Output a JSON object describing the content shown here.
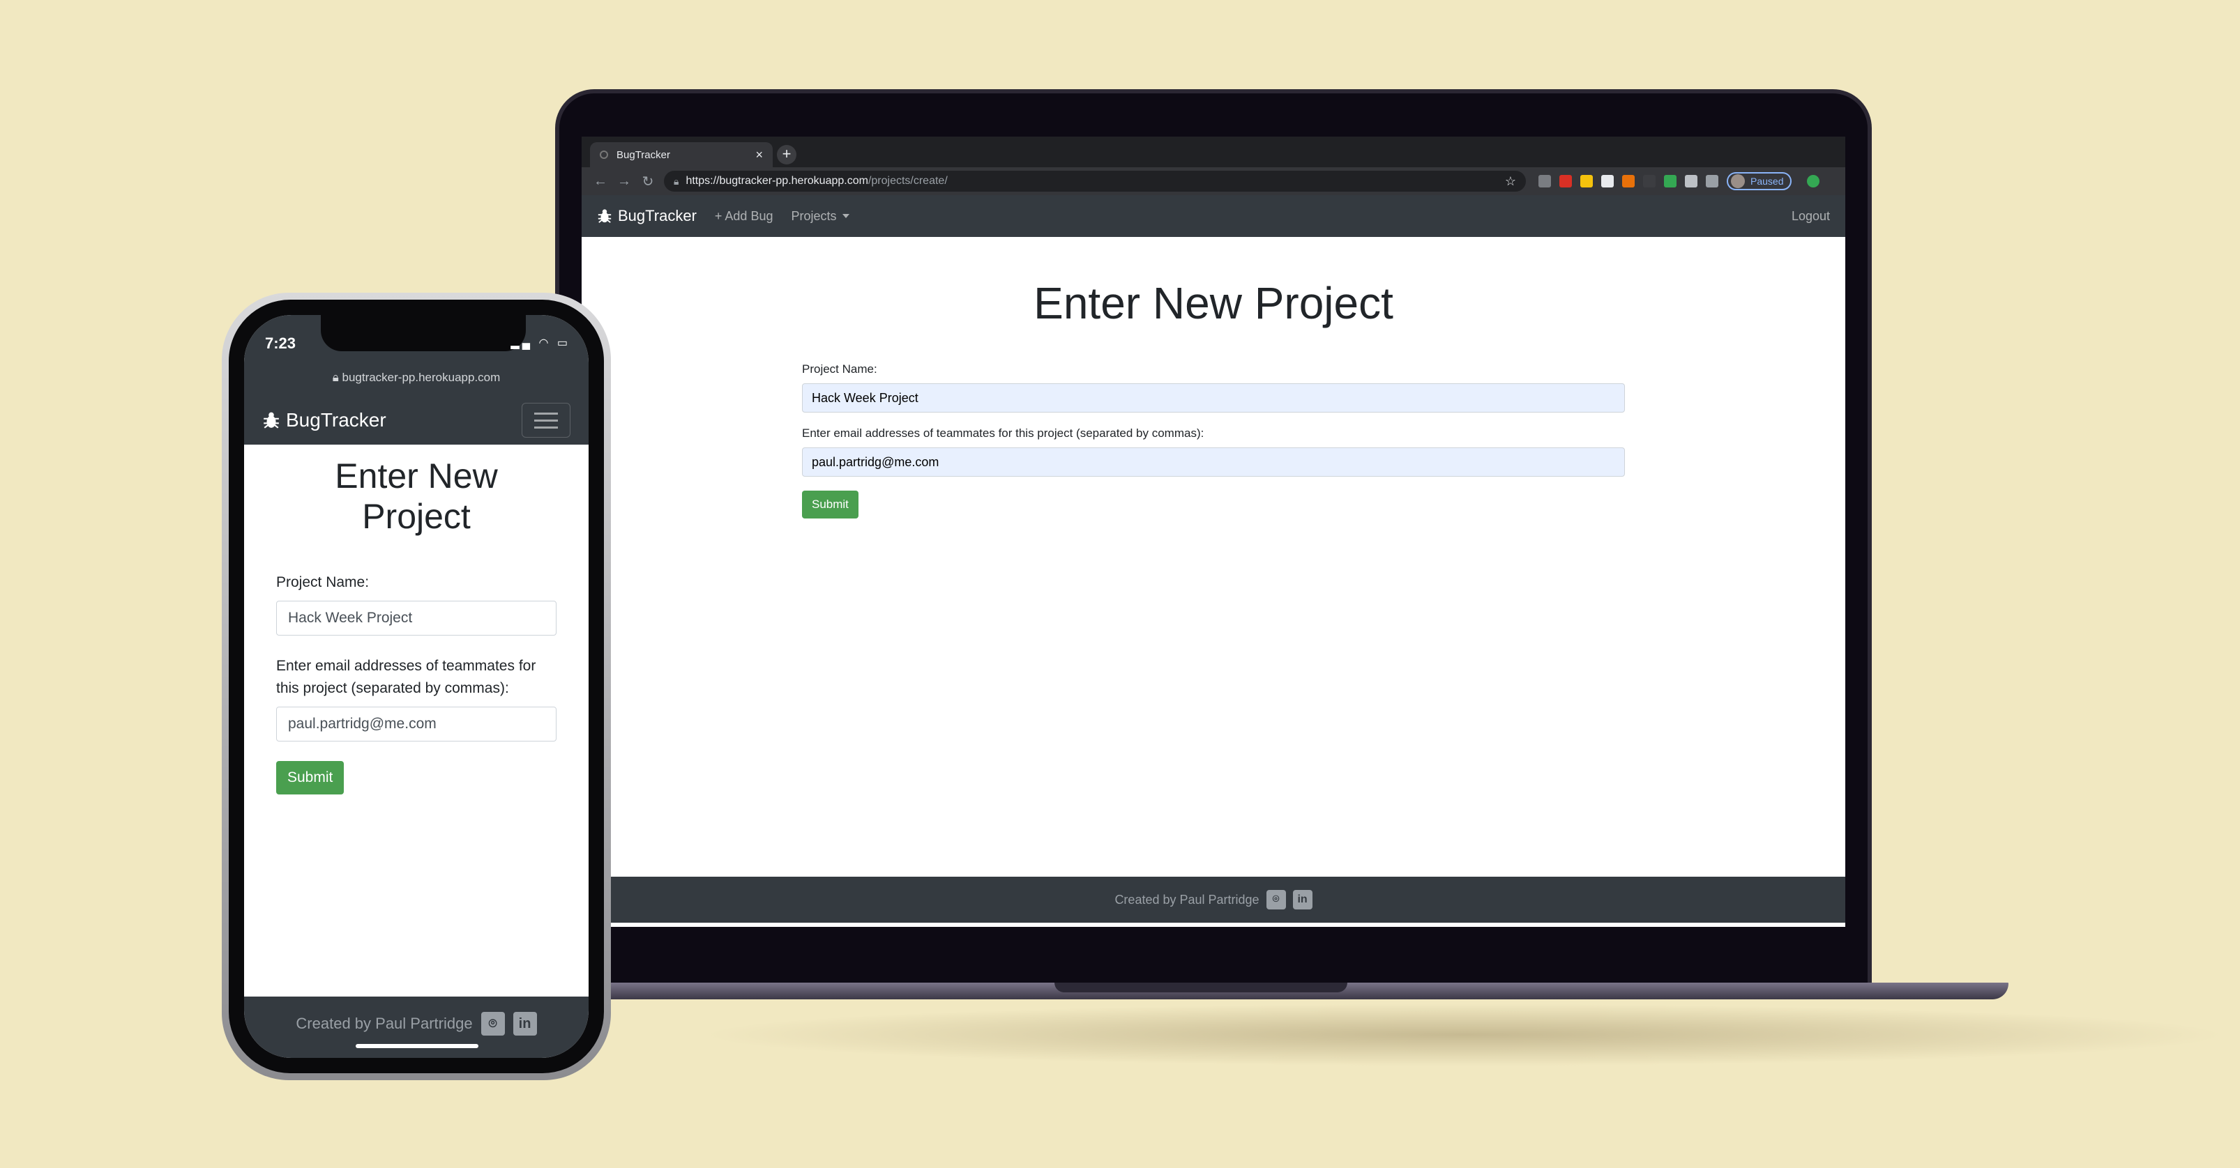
{
  "browser": {
    "tab_title": "BugTracker",
    "url_host": "https://bugtracker-pp.herokuapp.com",
    "url_path": "/projects/create/",
    "profile_label": "Paused"
  },
  "app": {
    "brand": "BugTracker",
    "nav_add_bug": "+ Add Bug",
    "nav_projects": "Projects",
    "nav_logout": "Logout",
    "page_title": "Enter New Project",
    "project_name_label": "Project Name:",
    "project_name_value": "Hack Week Project",
    "emails_label": "Enter email addresses of teammates for this project (separated by commas):",
    "emails_value": "paul.partridg@me.com",
    "submit_label": "Submit",
    "footer_text": "Created by Paul Partridge"
  },
  "phone": {
    "time": "7:23",
    "url": "bugtracker-pp.herokuapp.com",
    "emails_label": "Enter email addresses of teammates for this project (separated by commas):"
  },
  "colors": {
    "background": "#f1e8c1",
    "navbar": "#343a40",
    "submit": "#4a9f4f",
    "autofill": "#e8f0fe"
  }
}
